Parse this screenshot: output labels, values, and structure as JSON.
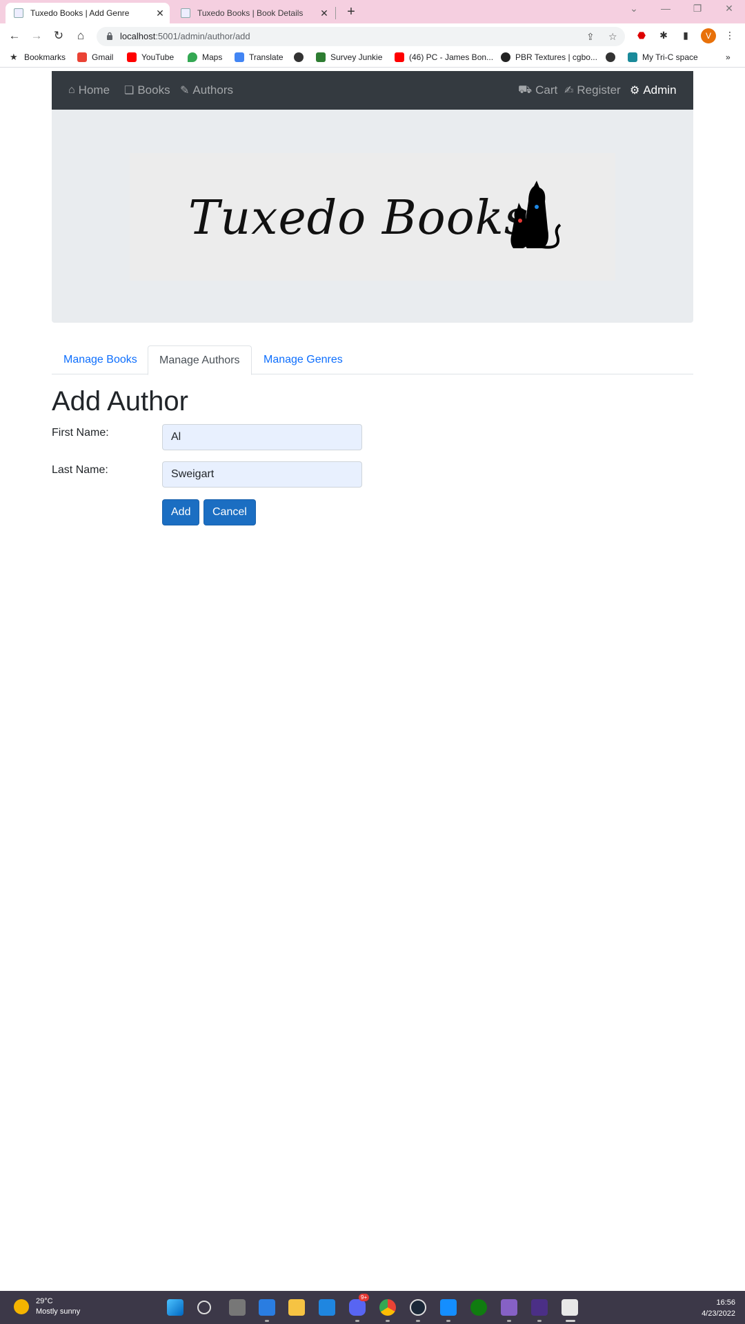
{
  "browser": {
    "tabs": [
      {
        "title": "Tuxedo Books | Add Genre",
        "active": true
      },
      {
        "title": "Tuxedo Books | Book Details",
        "active": false
      }
    ],
    "url_host": "localhost",
    "url_path": ":5001/admin/author/add",
    "profile_initial": "V",
    "bookmarks": [
      "Bookmarks",
      "Gmail",
      "YouTube",
      "Maps",
      "Translate",
      "Survey Junkie",
      "(46) PC - James Bon...",
      "PBR Textures | cgbo...",
      "My Tri-C space"
    ],
    "more_bookmarks": "»"
  },
  "site": {
    "nav_left": [
      {
        "label": "Home",
        "icon": "home-icon"
      },
      {
        "label": "Books",
        "icon": "book-icon"
      },
      {
        "label": "Authors",
        "icon": "feather-icon"
      }
    ],
    "nav_right": [
      {
        "label": "Cart",
        "icon": "cart-icon"
      },
      {
        "label": "Register",
        "icon": "edit-icon"
      },
      {
        "label": "Admin",
        "icon": "gear-icon"
      }
    ],
    "logo_text": "Tuxedo Books"
  },
  "admin_tabs": [
    {
      "label": "Manage Books",
      "active": false
    },
    {
      "label": "Manage Authors",
      "active": true
    },
    {
      "label": "Manage Genres",
      "active": false
    }
  ],
  "form": {
    "heading": "Add Author",
    "first_name_label": "First Name:",
    "first_name_value": "Al",
    "last_name_label": "Last Name:",
    "last_name_value": "Sweigart",
    "add_label": "Add",
    "cancel_label": "Cancel"
  },
  "taskbar": {
    "temperature": "29°C",
    "weather": "Mostly sunny",
    "time": "16:56",
    "date": "4/23/2022",
    "badge": "9+"
  },
  "colors": {
    "nav_bg": "#343a40",
    "link": "#0d6efd",
    "button": "#1b6ec2",
    "autofill": "#e8f0fe",
    "tab_strip": "#f5cfe0"
  }
}
